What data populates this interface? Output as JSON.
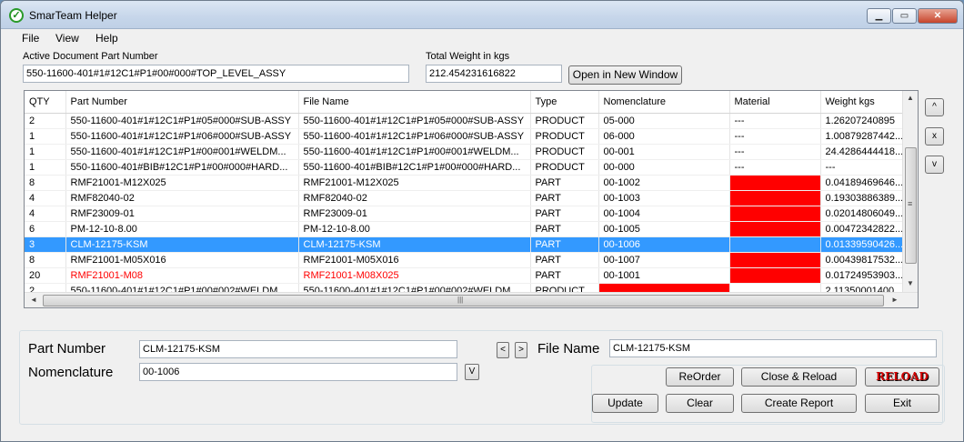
{
  "window": {
    "title": "SmarTeam Helper"
  },
  "icons": {
    "app": "check-circle-icon",
    "minimize": "minimize-icon",
    "maximize": "maximize-icon",
    "close": "close-icon"
  },
  "menu": [
    "File",
    "View",
    "Help"
  ],
  "active_doc": {
    "label": "Active Document Part Number",
    "value": "550-11600-401#1#12C1#P1#00#000#TOP_LEVEL_ASSY"
  },
  "total_weight": {
    "label": "Total Weight in kgs",
    "value": "212.454231616822"
  },
  "open_new_window_label": "Open in New Window",
  "grid": {
    "columns": [
      "QTY",
      "Part Number",
      "File Name",
      "Type",
      "Nomenclature",
      "Material",
      "Weight kgs"
    ],
    "rows": [
      {
        "qty": "2",
        "part": "550-11600-401#1#12C1#P1#05#000#SUB-ASSY",
        "file": "550-11600-401#1#12C1#P1#05#000#SUB-ASSY",
        "type": "PRODUCT",
        "nom": "05-000",
        "mat": "---",
        "weight": "1.26207240895"
      },
      {
        "qty": "1",
        "part": "550-11600-401#1#12C1#P1#06#000#SUB-ASSY",
        "file": "550-11600-401#1#12C1#P1#06#000#SUB-ASSY",
        "type": "PRODUCT",
        "nom": "06-000",
        "mat": "---",
        "weight": "1.00879287442..."
      },
      {
        "qty": "1",
        "part": "550-11600-401#1#12C1#P1#00#001#WELDM...",
        "file": "550-11600-401#1#12C1#P1#00#001#WELDM...",
        "type": "PRODUCT",
        "nom": "00-001",
        "mat": "---",
        "weight": "24.4286444418..."
      },
      {
        "qty": "1",
        "part": "550-11600-401#BIB#12C1#P1#00#000#HARD...",
        "file": "550-11600-401#BIB#12C1#P1#00#000#HARD...",
        "type": "PRODUCT",
        "nom": "00-000",
        "mat": "---",
        "weight": "---"
      },
      {
        "qty": "8",
        "part": "RMF21001-M12X025",
        "file": "RMF21001-M12X025",
        "type": "PART",
        "nom": "00-1002",
        "mat": "",
        "weight": "0.04189469646..."
      },
      {
        "qty": "4",
        "part": "RMF82040-02",
        "file": "RMF82040-02",
        "type": "PART",
        "nom": "00-1003",
        "mat": "",
        "weight": "0.19303886389..."
      },
      {
        "qty": "4",
        "part": "RMF23009-01",
        "file": "RMF23009-01",
        "type": "PART",
        "nom": "00-1004",
        "mat": "",
        "weight": "0.02014806049..."
      },
      {
        "qty": "6",
        "part": "PM-12-10-8.00",
        "file": "PM-12-10-8.00",
        "type": "PART",
        "nom": "00-1005",
        "mat": "",
        "weight": "0.00472342822..."
      },
      {
        "qty": "3",
        "part": "CLM-12175-KSM",
        "file": "CLM-12175-KSM",
        "type": "PART",
        "nom": "00-1006",
        "mat": "",
        "weight": "0.01339590426..."
      },
      {
        "qty": "8",
        "part": "RMF21001-M05X016",
        "file": "RMF21001-M05X016",
        "type": "PART",
        "nom": "00-1007",
        "mat": "",
        "weight": "0.00439817532..."
      },
      {
        "qty": "20",
        "part": "RMF21001-M08",
        "file": "RMF21001-M08X025",
        "type": "PART",
        "nom": "00-1001",
        "mat": "",
        "weight": "0.01724953903..."
      },
      {
        "qty": "2",
        "part": "550-11600-401#1#12C1#P1#00#002#WELDM...",
        "file": "550-11600-401#1#12C1#P1#00#002#WELDM...",
        "type": "PRODUCT",
        "nom": "",
        "mat": "",
        "weight": "2.11350001400"
      }
    ],
    "selected_row": 8,
    "vscroll_up": "▲",
    "vscroll_down": "▼",
    "hscroll_left": "◄",
    "hscroll_right": "►",
    "grip": "|||",
    "vgrip": "≡"
  },
  "side_buttons": {
    "up": "^",
    "remove": "x",
    "down": "v"
  },
  "detail": {
    "part_number_label": "Part Number",
    "part_number_value": "CLM-12175-KSM",
    "nomenclature_label": "Nomenclature",
    "nomenclature_value": "00-1006",
    "file_name_label": "File Name",
    "file_name_value": "CLM-12175-KSM",
    "prev_label": "<",
    "next_label": ">",
    "v_label": "V"
  },
  "actions": {
    "reorder": "ReOrder",
    "close_reload": "Close & Reload",
    "reload": "RELOAD",
    "update": "Update",
    "clear": "Clear",
    "create_report": "Create Report",
    "exit": "Exit"
  },
  "colors": {
    "selection": "#3399ff",
    "missing_material": "#ff0000"
  }
}
